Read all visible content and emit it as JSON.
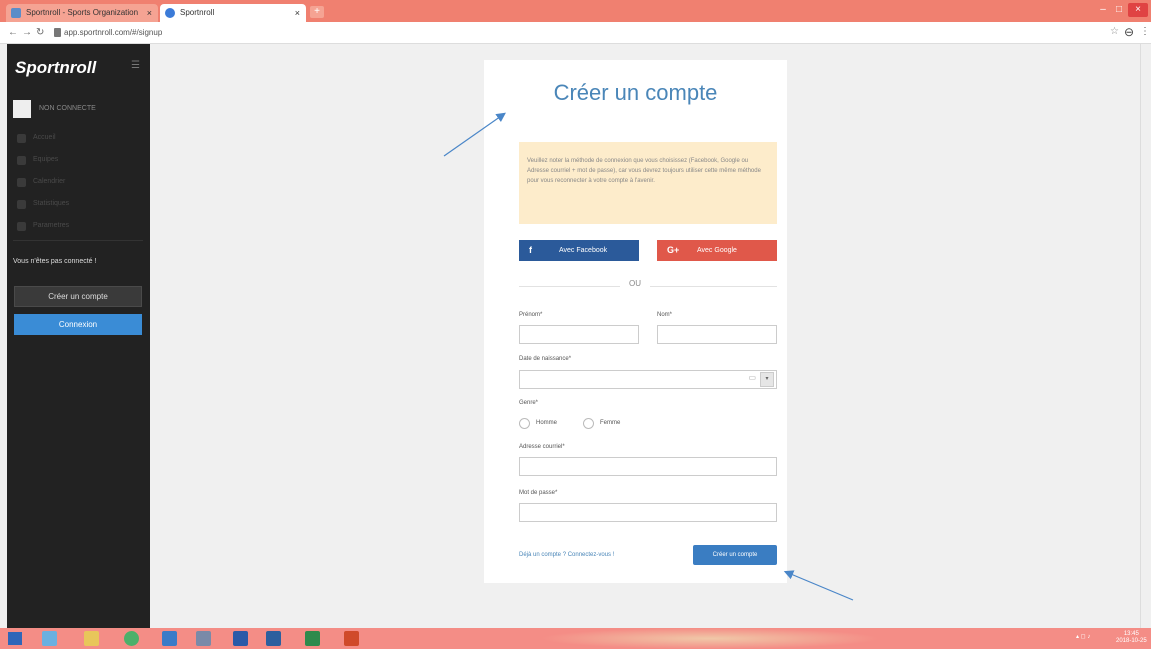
{
  "browser": {
    "tabs": [
      {
        "label": "Sportnroll - Sports Organization"
      },
      {
        "label": "Sportnroll"
      }
    ],
    "url": "app.sportnroll.com/#/signup",
    "new_tab_icon": "plus-icon"
  },
  "sidebar": {
    "brand": "Sportnroll",
    "menu_icon": "hamburger-icon",
    "user_label": "NON CONNECTE",
    "items": [
      {
        "label": "Accueil",
        "icon": "home-icon"
      },
      {
        "label": "Equipes",
        "icon": "team-icon"
      },
      {
        "label": "Calendrier",
        "icon": "calendar-icon"
      },
      {
        "label": "Statistiques",
        "icon": "stats-icon"
      },
      {
        "label": "Parametres",
        "icon": "gear-icon"
      }
    ],
    "status_text": "Vous n'êtes pas connecté !",
    "create_account": "Créer un compte",
    "login": "Connexion"
  },
  "signup": {
    "title": "Créer un compte",
    "notice": "Veuillez noter la méthode de connexion que vous choisissez (Facebook, Google ou Adresse courriel + mot de passe), car vous devrez toujours utiliser cette même méthode pour vous reconnecter à votre compte à l'avenir.",
    "facebook_label": "Avec Facebook",
    "google_label": "Avec Google",
    "facebook_icon": "f",
    "google_icon": "G+",
    "or_label": "OU",
    "firstname_label": "Prénom*",
    "lastname_label": "Nom*",
    "birthdate_label": "Date de naissance*",
    "gender_label": "Genre*",
    "gender_male": "Homme",
    "gender_female": "Femme",
    "email_label": "Adresse courriel*",
    "password_label": "Mot de passe*",
    "login_link": "Déjà un compte ? Connectez-vous !",
    "submit_label": "Créer un compte"
  },
  "taskbar": {
    "clock_time": "13:45",
    "clock_date": "2018-10-25"
  },
  "colors": {
    "accent": "#4a86b8",
    "facebook": "#2b5a9a",
    "google": "#e0584a",
    "sidebar_bg": "#222222",
    "notice_bg": "#fdeccb",
    "tabbar": "#f08070"
  }
}
